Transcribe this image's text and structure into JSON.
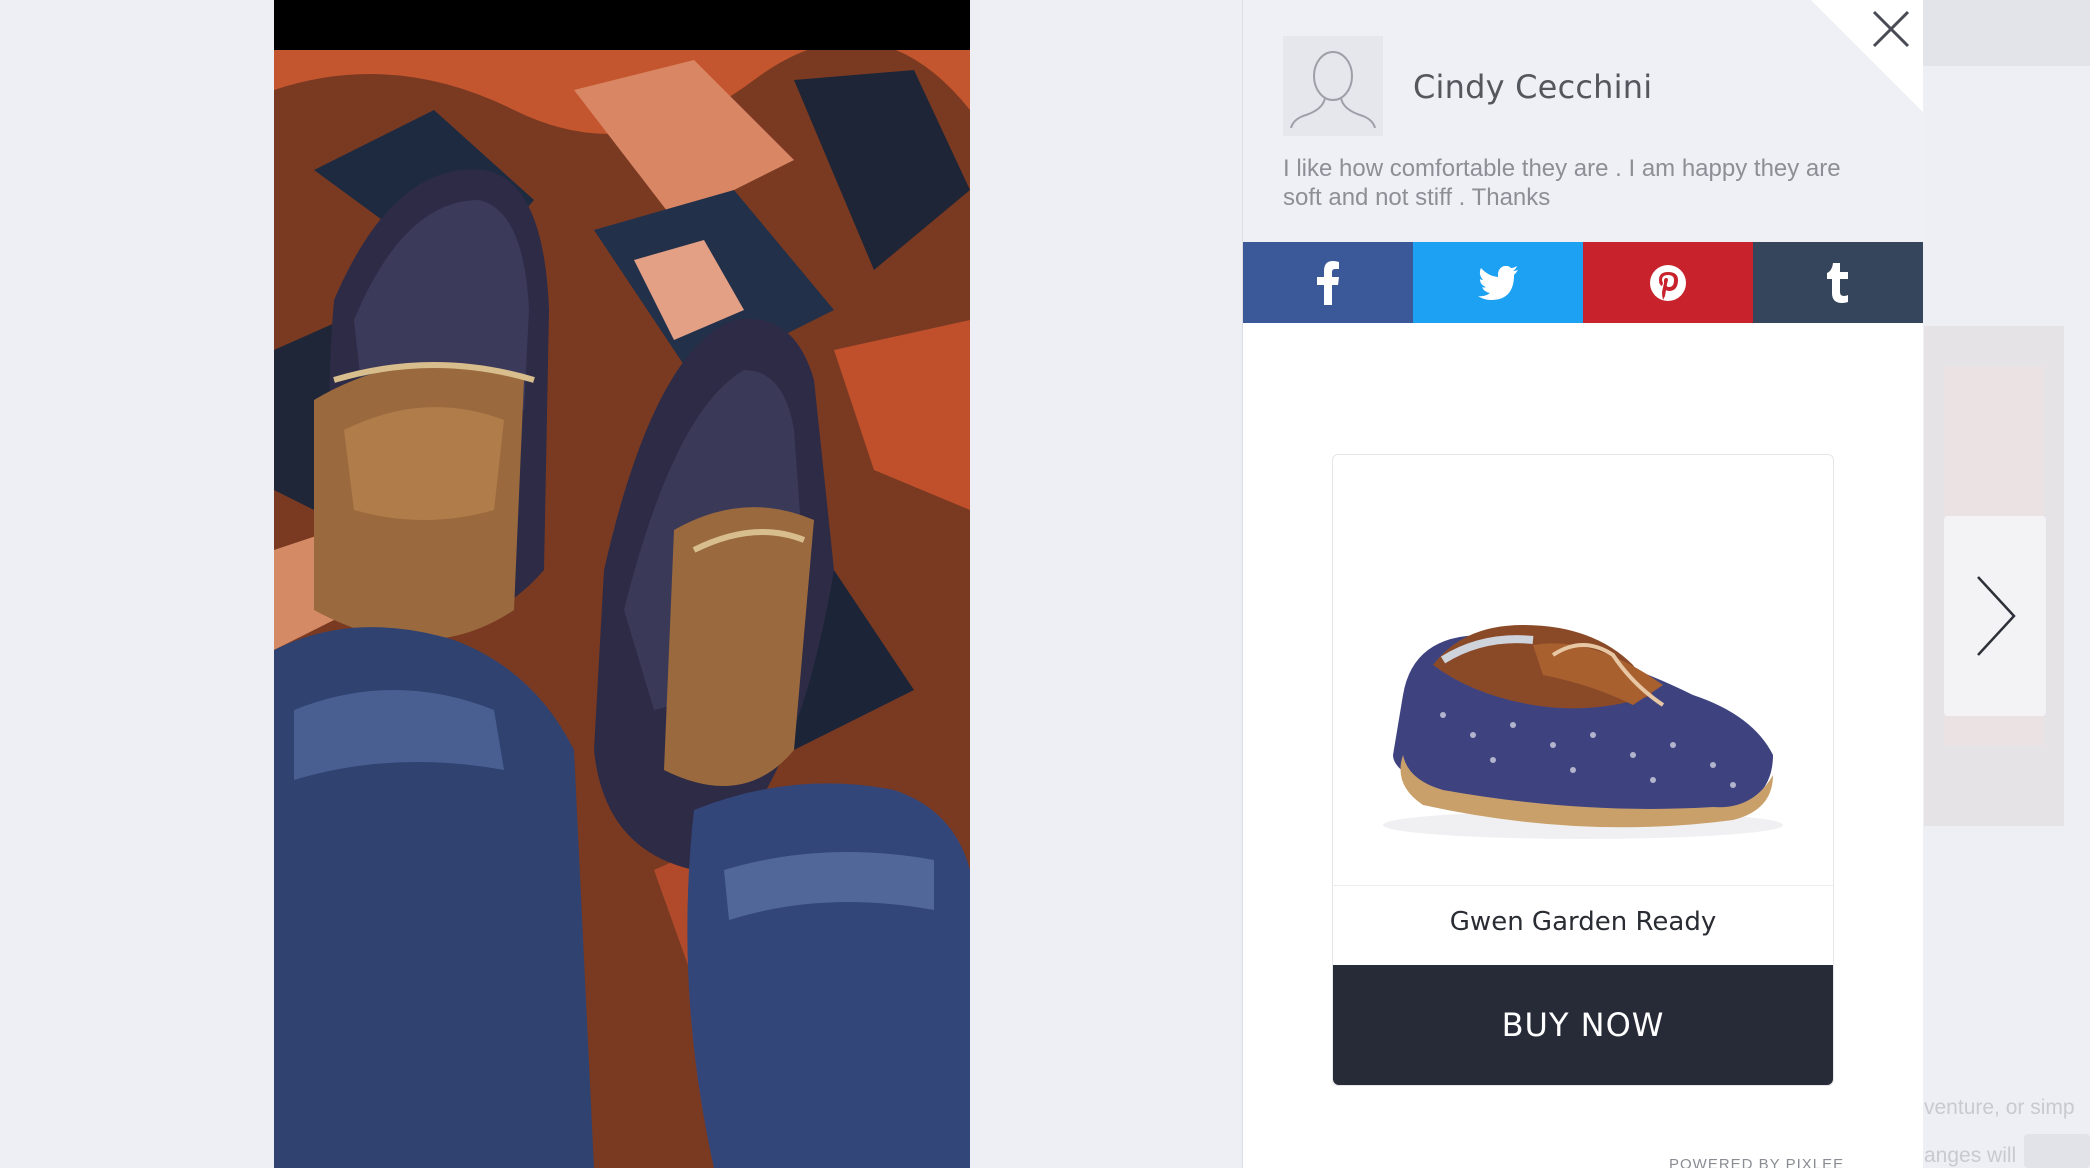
{
  "review": {
    "author": "Cindy Cecchini",
    "text": "I like how comfortable they are . I am happy they are soft and not stiff . Thanks"
  },
  "share": {
    "facebook_icon": "facebook-icon",
    "twitter_icon": "twitter-icon",
    "pinterest_icon": "pinterest-icon",
    "tumblr_icon": "tumblr-icon",
    "colors": {
      "facebook": "#3b5998",
      "twitter": "#1da1f2",
      "pinterest": "#c8232c",
      "tumblr": "#35465c"
    }
  },
  "product": {
    "name": "Gwen Garden Ready",
    "buy_label": "BUY NOW"
  },
  "footer": {
    "powered": "POWERED BY PIXLEE"
  },
  "background": {
    "text_1": "venture, or simp",
    "text_2": "anges will"
  },
  "icons": {
    "close": "close-icon",
    "next": "chevron-right-icon",
    "avatar": "user-avatar-icon"
  }
}
